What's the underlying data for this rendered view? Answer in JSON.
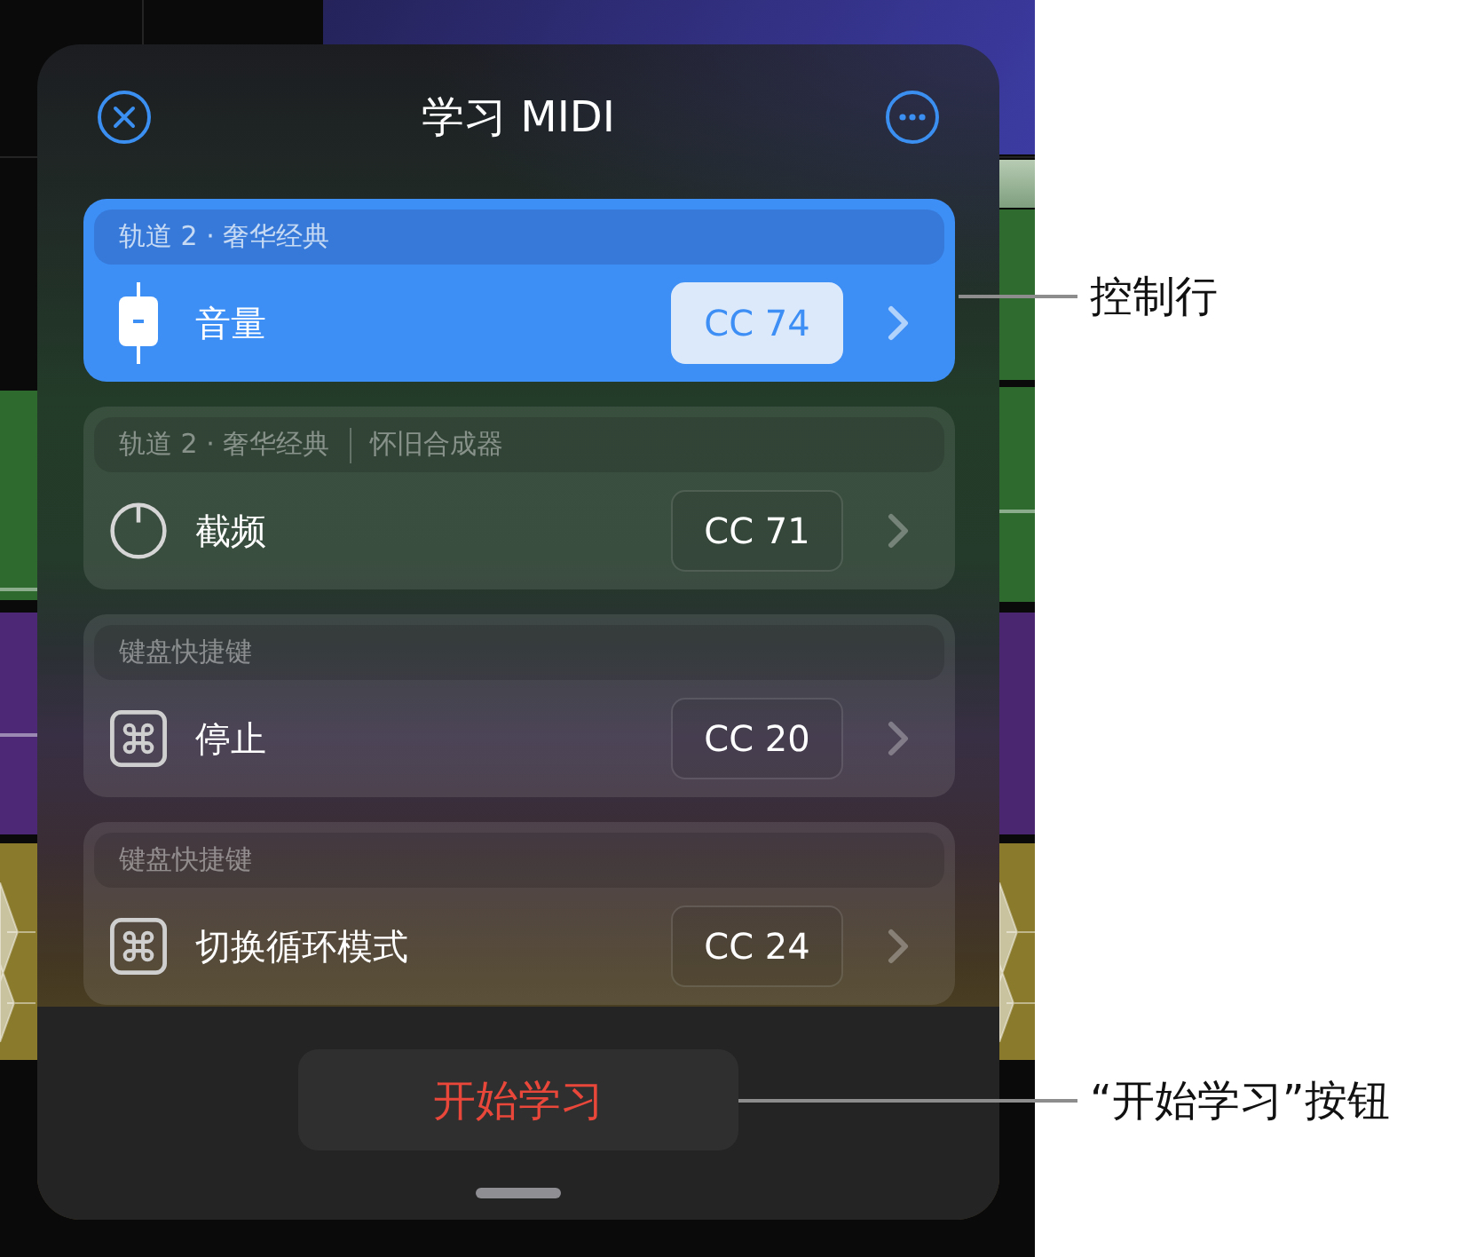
{
  "dialog": {
    "title": "学习 MIDI"
  },
  "controls": [
    {
      "kind": "fader",
      "selected": true,
      "source": [
        "轨道 2 · 奢华经典"
      ],
      "name": "音量",
      "cc": "CC 74"
    },
    {
      "kind": "knob",
      "selected": false,
      "source": [
        "轨道 2 · 奢华经典",
        "怀旧合成器"
      ],
      "name": "截频",
      "cc": "CC 71"
    },
    {
      "kind": "key-command",
      "selected": false,
      "source": [
        "键盘快捷键"
      ],
      "name": "停止",
      "cc": "CC 20"
    },
    {
      "kind": "key-command",
      "selected": false,
      "source": [
        "键盘快捷键"
      ],
      "name": "切换循环模式",
      "cc": "CC 24"
    }
  ],
  "start_button": {
    "label": "开始学习"
  },
  "callouts": [
    {
      "label": "控制行"
    },
    {
      "label": "“开始学习”按钮"
    }
  ]
}
